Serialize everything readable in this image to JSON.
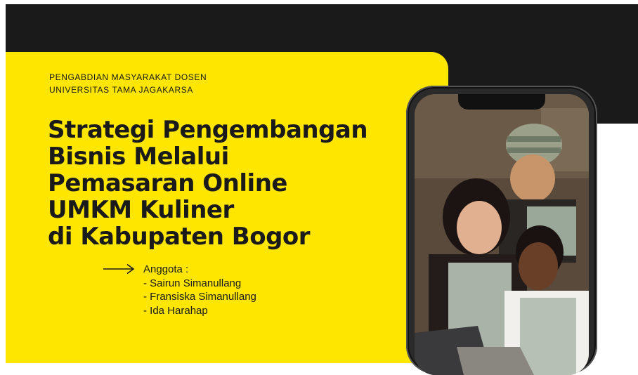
{
  "header": {
    "org_line1": "PENGABDIAN MASYARAKAT DOSEN",
    "org_line2": "UNIVERSITAS TAMA JAGAKARSA"
  },
  "title_lines": [
    "Strategi Pengembangan",
    "Bisnis Melalui",
    "Pemasaran Online",
    "UMKM Kuliner",
    "di Kabupaten Bogor"
  ],
  "members": {
    "label": "Anggota :",
    "names": [
      "- Sairun Simanullang",
      "- Fransiska Simanullang",
      "- Ida Harahap"
    ]
  },
  "icons": {
    "arrow": "arrow-right-icon"
  },
  "colors": {
    "accent_yellow": "#ffe600",
    "dark": "#1a1a1a"
  }
}
